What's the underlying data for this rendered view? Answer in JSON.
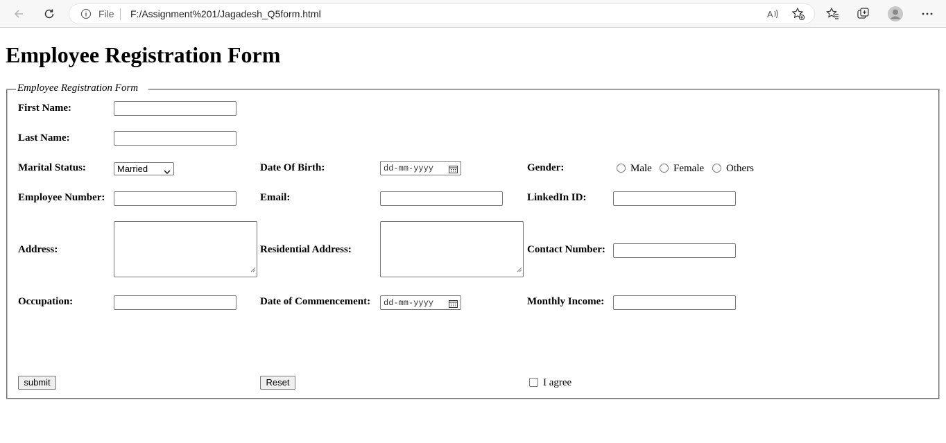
{
  "browser": {
    "file_label": "File",
    "url": "F:/Assignment%201/Jagadesh_Q5form.html"
  },
  "page": {
    "heading": "Employee Registration Form",
    "legend": "Employee Registration Form"
  },
  "form": {
    "first_name_label": "First Name:",
    "last_name_label": "Last Name:",
    "marital_status_label": "Marital Status:",
    "marital_status_value": "Married",
    "dob_label": "Date Of Birth:",
    "date_placeholder": "dd-mm-yyyy",
    "gender_label": "Gender:",
    "gender_options": [
      "Male",
      "Female",
      "Others"
    ],
    "employee_number_label": "Employee Number:",
    "email_label": "Email:",
    "linkedin_label": "LinkedIn ID:",
    "address_label": "Address:",
    "residential_address_label": "Residential Address:",
    "contact_number_label": "Contact Number:",
    "occupation_label": "Occupation:",
    "commencement_label": "Date of Commencement:",
    "monthly_income_label": "Monthly Income:",
    "submit_label": "submit",
    "reset_label": "Reset",
    "agree_label": "I agree"
  }
}
